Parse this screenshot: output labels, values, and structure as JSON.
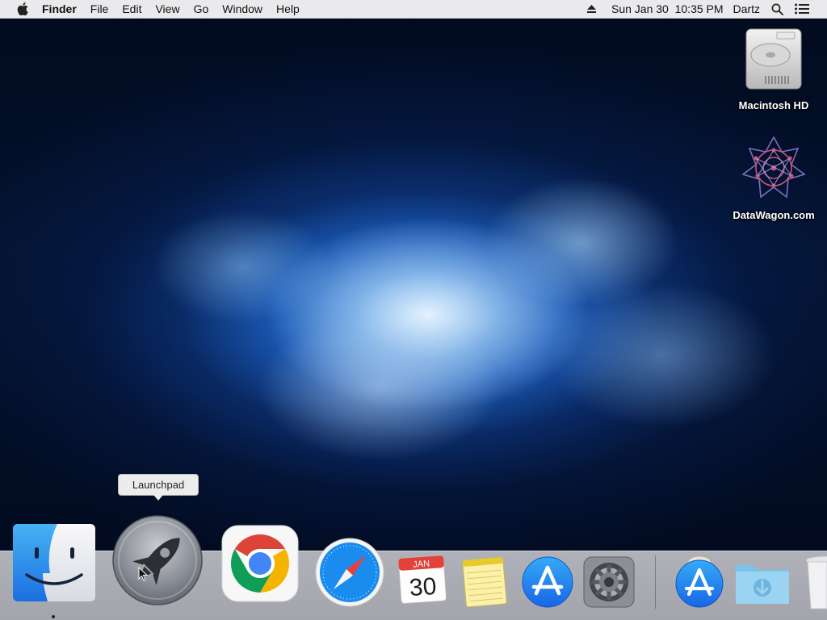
{
  "menubar": {
    "apple_icon": "apple-logo-icon",
    "app_name": "Finder",
    "menus": [
      "File",
      "Edit",
      "View",
      "Go",
      "Window",
      "Help"
    ],
    "eject_icon": "eject-icon",
    "datetime": "Sun Jan 30  10:35 PM",
    "user": "Dartz",
    "search_icon": "magnifier-icon",
    "notification_icon": "notification-center-icon"
  },
  "desktop": {
    "icons": [
      {
        "label": "Macintosh HD",
        "icon": "hard-drive-icon"
      },
      {
        "label": "DataWagon.com",
        "icon": "datawagon-icon"
      }
    ]
  },
  "tooltip": {
    "text": "Launchpad"
  },
  "dock": {
    "apps": [
      {
        "name": "Finder",
        "icon": "finder-icon",
        "running": true
      },
      {
        "name": "Launchpad",
        "icon": "launchpad-rocket-icon",
        "running": false
      },
      {
        "name": "Google Chrome",
        "icon": "chrome-icon",
        "running": false
      },
      {
        "name": "Safari",
        "icon": "safari-compass-icon",
        "running": false
      },
      {
        "name": "Calendar",
        "icon": "calendar-icon",
        "running": false,
        "month": "JAN",
        "day": "30"
      },
      {
        "name": "Notes",
        "icon": "notes-icon",
        "running": false
      },
      {
        "name": "App Store",
        "icon": "app-store-icon",
        "running": false
      },
      {
        "name": "System Preferences",
        "icon": "gear-icon",
        "running": false
      },
      {
        "name": "App Store Installer",
        "icon": "app-store-installer-icon",
        "running": false
      },
      {
        "name": "Downloads",
        "icon": "downloads-folder-icon",
        "running": false
      },
      {
        "name": "Trash",
        "icon": "trash-icon",
        "running": false
      }
    ]
  },
  "colors": {
    "menubar_bg": "#f4f4f6",
    "safari_blue": "#1a8cf0",
    "appstore_blue": "#1e7ef2",
    "chrome_red": "#db4437",
    "chrome_green": "#0f9d58",
    "chrome_yellow": "#f4b400",
    "chrome_blue": "#4285f4"
  }
}
